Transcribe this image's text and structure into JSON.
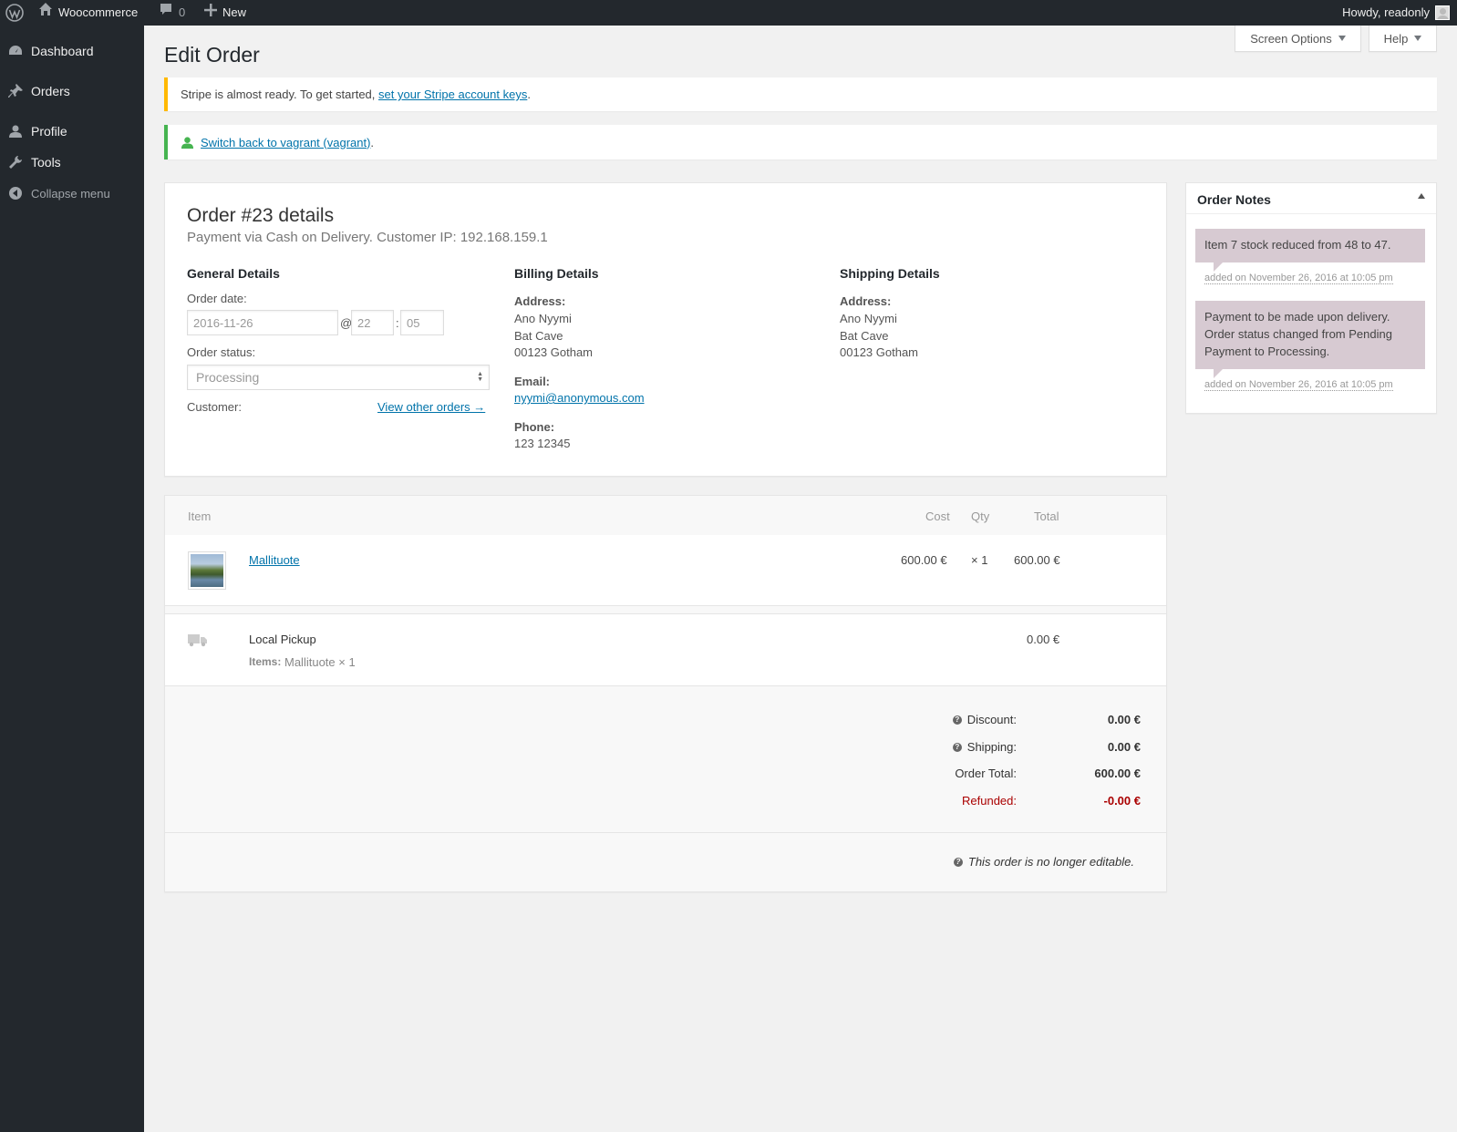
{
  "admin_bar": {
    "site_name": "Woocommerce",
    "comments_count": "0",
    "new_label": "New",
    "howdy": "Howdy, readonly"
  },
  "sidebar": {
    "items": [
      {
        "label": "Dashboard",
        "icon": "dashboard-icon"
      },
      {
        "label": "Orders",
        "icon": "pin-icon"
      },
      {
        "label": "Profile",
        "icon": "user-icon"
      },
      {
        "label": "Tools",
        "icon": "wrench-icon"
      },
      {
        "label": "Collapse menu",
        "icon": "collapse-icon"
      }
    ]
  },
  "header": {
    "title": "Edit Order",
    "screen_options": "Screen Options",
    "help": "Help"
  },
  "notices": {
    "stripe_text": "Stripe is almost ready. To get started,",
    "stripe_link": "set your Stripe account keys",
    "switch_link": "Switch back to vagrant (vagrant)"
  },
  "order": {
    "title": "Order #23 details",
    "subtitle": "Payment via Cash on Delivery. Customer IP: 192.168.159.1",
    "general": {
      "heading": "General Details",
      "order_date_label": "Order date:",
      "date": "2016-11-26",
      "at": "@",
      "hour": "22",
      "colon": ":",
      "minute": "05",
      "status_label": "Order status:",
      "status": "Processing",
      "customer_label": "Customer:",
      "view_orders": "View other orders →"
    },
    "billing": {
      "heading": "Billing Details",
      "address_label": "Address:",
      "address": [
        "Ano Nyymi",
        "Bat Cave",
        "00123 Gotham"
      ],
      "email_label": "Email:",
      "email": "nyymi@anonymous.com",
      "phone_label": "Phone:",
      "phone": "123 12345"
    },
    "shipping": {
      "heading": "Shipping Details",
      "address_label": "Address:",
      "address": [
        "Ano Nyymi",
        "Bat Cave",
        "00123 Gotham"
      ]
    }
  },
  "items": {
    "headers": {
      "item": "Item",
      "cost": "Cost",
      "qty": "Qty",
      "total": "Total"
    },
    "line": {
      "name": "Mallituote",
      "cost": "600.00 €",
      "qty": "× 1",
      "total": "600.00 €"
    },
    "shipping_line": {
      "name": "Local Pickup",
      "items_label": "Items:",
      "items": "Mallituote × 1",
      "total": "0.00 €"
    },
    "totals": {
      "discount_label": "Discount:",
      "discount": "0.00 €",
      "shipping_label": "Shipping:",
      "shipping": "0.00 €",
      "order_total_label": "Order Total:",
      "order_total": "600.00 €",
      "refunded_label": "Refunded:",
      "refunded": "-0.00 €"
    },
    "not_editable": "This order is no longer editable."
  },
  "order_notes": {
    "title": "Order Notes",
    "notes": [
      {
        "text": "Item 7 stock reduced from 48 to 47.",
        "meta": "added on November 26, 2016 at 10:05 pm"
      },
      {
        "text": "Payment to be made upon delivery. Order status changed from Pending Payment to Processing.",
        "meta": "added on November 26, 2016 at 10:05 pm"
      }
    ]
  },
  "colors": {
    "accent": "#0073aa",
    "refund": "#a00",
    "note_bg": "#d7cad2",
    "warning": "#ffb900",
    "success": "#46b450"
  }
}
